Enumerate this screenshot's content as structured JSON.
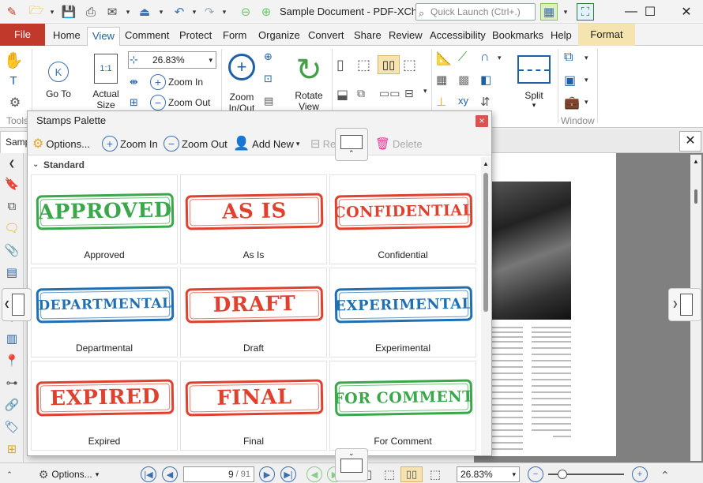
{
  "window": {
    "title": "Sample Document - PDF-XCha...",
    "quick_launch_placeholder": "Quick Launch (Ctrl+.)"
  },
  "ribbon_tabs": [
    "File",
    "Home",
    "View",
    "Comment",
    "Protect",
    "Form",
    "Organize",
    "Convert",
    "Share",
    "Review",
    "Accessibility",
    "Bookmarks",
    "Help",
    "Format"
  ],
  "active_tab": "View",
  "ribbon": {
    "go_to": "Go To",
    "actual_size": "Actual Size",
    "zoom_value": "26.83%",
    "zoom_in": "Zoom In",
    "zoom_out": "Zoom Out",
    "zoom_in_out": "Zoom In/Out",
    "rotate_view": "Rotate View",
    "split": "Split",
    "tools_group": "Tools",
    "window_group": "Window"
  },
  "doc_tab": "Samp",
  "palette": {
    "title": "Stamps Palette",
    "toolbar": {
      "options": "Options...",
      "zoom_in": "Zoom In",
      "zoom_out": "Zoom Out",
      "add_new": "Add New",
      "rename": "Rename",
      "delete": "Delete"
    },
    "section": "Standard",
    "stamps": [
      {
        "text": "APPROVED",
        "label": "Approved",
        "color": "#3aa84a"
      },
      {
        "text": "AS IS",
        "label": "As Is",
        "color": "#e0412f"
      },
      {
        "text": "CONFIDENTIAL",
        "label": "Confidential",
        "color": "#e0412f"
      },
      {
        "text": "DEPARTMENTAL",
        "label": "Departmental",
        "color": "#1f6fb5"
      },
      {
        "text": "DRAFT",
        "label": "Draft",
        "color": "#e0412f"
      },
      {
        "text": "EXPERIMENTAL",
        "label": "Experimental",
        "color": "#1f6fb5"
      },
      {
        "text": "EXPIRED",
        "label": "Expired",
        "color": "#e0412f"
      },
      {
        "text": "FINAL",
        "label": "Final",
        "color": "#e0412f"
      },
      {
        "text": "FOR COMMENT",
        "label": "For Comment",
        "color": "#3aa84a"
      }
    ]
  },
  "status_bar": {
    "options": "Options...",
    "page_input": "9",
    "page_total": "/ 91",
    "zoom_value": "26.83%"
  }
}
